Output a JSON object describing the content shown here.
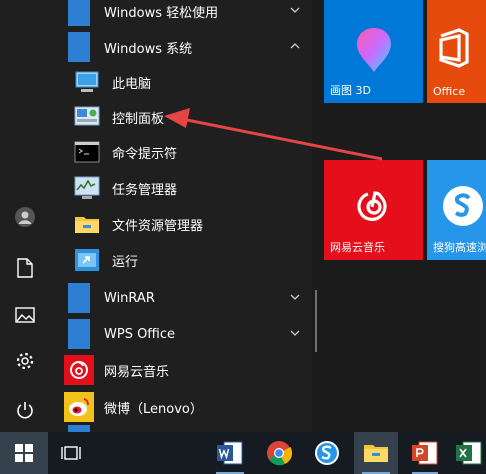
{
  "start_menu": {
    "apps": [
      {
        "label": "Windows 轻松使用",
        "type": "folder",
        "expanded": false
      },
      {
        "label": "Windows 系统",
        "type": "folder",
        "expanded": true
      },
      {
        "label": "此电脑",
        "type": "app",
        "icon": "computer-icon"
      },
      {
        "label": "控制面板",
        "type": "app",
        "icon": "control-panel-icon"
      },
      {
        "label": "命令提示符",
        "type": "app",
        "icon": "cmd-icon"
      },
      {
        "label": "任务管理器",
        "type": "app",
        "icon": "task-manager-icon"
      },
      {
        "label": "文件资源管理器",
        "type": "app",
        "icon": "file-explorer-icon"
      },
      {
        "label": "运行",
        "type": "app",
        "icon": "run-icon"
      },
      {
        "label": "WinRAR",
        "type": "folder",
        "expanded": false
      },
      {
        "label": "WPS Office",
        "type": "folder",
        "expanded": false
      },
      {
        "label": "网易云音乐",
        "type": "app",
        "icon": "netease-music-icon"
      },
      {
        "label": "微博（Lenovo）",
        "type": "app",
        "icon": "weibo-icon"
      }
    ],
    "tiles": [
      {
        "label": "画图 3D",
        "color": "#0078d7"
      },
      {
        "label": "Office",
        "color": "#e74a0d"
      },
      {
        "label": "网易云音乐",
        "color": "#e50f1c"
      },
      {
        "label": "搜狗高速浏",
        "color": "#2596ea"
      }
    ]
  },
  "colors": {
    "accent": "#0078d7",
    "annotation_arrow": "#e64545",
    "folder": "#2d7fd3"
  },
  "taskbar": {
    "items": [
      "start-icon",
      "task-view-icon",
      "word-icon",
      "chrome-icon",
      "sogou-browser-icon",
      "file-explorer-icon",
      "powerpoint-icon",
      "excel-icon"
    ],
    "active": "file-explorer-icon"
  }
}
